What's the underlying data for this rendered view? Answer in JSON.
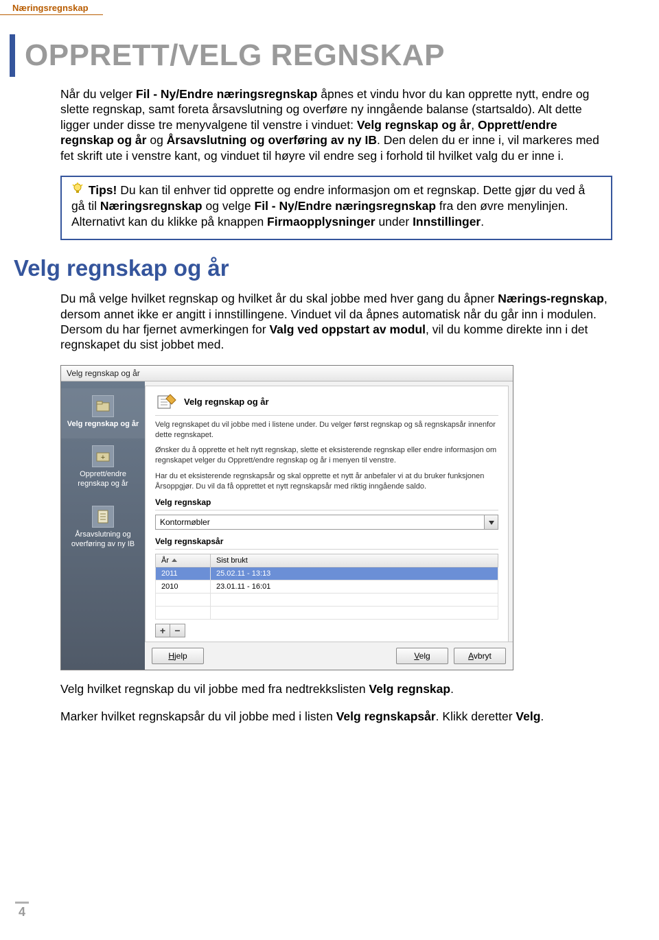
{
  "header": "Næringsregnskap",
  "title": "OPPRETT/VELG REGNSKAP",
  "intro_html": "Når du velger <b>Fil - Ny/Endre næringsregnskap</b> åpnes et vindu hvor du kan opprette nytt, endre og slette regnskap, samt foreta årsavslutning og overføre ny inngående balanse (startsaldo). Alt dette ligger under disse tre menyvalgene til venstre i vinduet: <b>Velg regnskap og år</b>, <b>Opprett/endre regnskap og år</b> og <b>Årsavslutning og overføring av ny IB</b>. Den delen du er inne i, vil markeres med fet skrift ute i venstre kant, og vinduet til høyre vil endre seg i forhold til hvilket valg du er inne i.",
  "tips_label": "Tips!",
  "tips_html": "Du kan til enhver tid opprette og endre informasjon om et regnskap. Dette gjør du ved å gå til <b>Næringsregnskap</b> og velge <b>Fil - Ny/Endre næringsregnskap</b> fra den øvre menylinjen. Alternativt kan du klikke på knappen <b>Firmaopplysninger</b> under <b>Innstillinger</b>.",
  "sub_title": "Velg regnskap og år",
  "section_para_html": "Du må velge hvilket regnskap og hvilket år du skal jobbe med hver gang du åpner <b>Nærings-regnskap</b>, dersom annet ikke er angitt i innstillingene. Vinduet vil da åpnes automatisk når du går inn i modulen. Dersom du har fjernet avmerkingen for <b>Valg ved oppstart av modul</b>, vil du komme direkte inn i det regnskapet du sist jobbet med.",
  "dialog": {
    "title": "Velg regnskap og år",
    "sidebar": [
      {
        "label": "Velg regnskap og år",
        "selected": true
      },
      {
        "label": "Opprett/endre regnskap og år",
        "selected": false
      },
      {
        "label": "Årsavslutning og overføring av ny IB",
        "selected": false
      }
    ],
    "content_title": "Velg regnskap og år",
    "para1": "Velg regnskapet du vil jobbe med i listene under. Du velger først regnskap og så regnskapsår innenfor dette regnskapet.",
    "para2": "Ønsker du å opprette et helt nytt regnskap, slette et eksisterende regnskap eller endre informasjon om regnskapet velger du Opprett/endre regnskap og år i menyen til venstre.",
    "para3": "Har du et eksisterende regnskapsår og skal opprette et nytt år anbefaler vi at du bruker funksjonen Årsoppgjør. Du vil da få opprettet et nytt regnskapsår med riktig inngående saldo.",
    "section1": "Velg regnskap",
    "combo_value": "Kontormøbler",
    "section2": "Velg regnskapsår",
    "col_year": "År",
    "col_last": "Sist brukt",
    "rows": [
      {
        "year": "2011",
        "last": "25.02.11 - 13:13",
        "selected": true
      },
      {
        "year": "2010",
        "last": "23.01.11 - 16:01",
        "selected": false
      }
    ],
    "btn_help": "Hjelp",
    "btn_select": "Velg",
    "btn_cancel": "Avbryt"
  },
  "after1_html": "Velg hvilket regnskap du vil jobbe med fra nedtrekkslisten <b>Velg regnskap</b>.",
  "after2_html": "Marker hvilket regnskapsår du vil jobbe med i listen <b>Velg regnskapsår</b>. Klikk deretter <b>Velg</b>.",
  "page_number": "4"
}
